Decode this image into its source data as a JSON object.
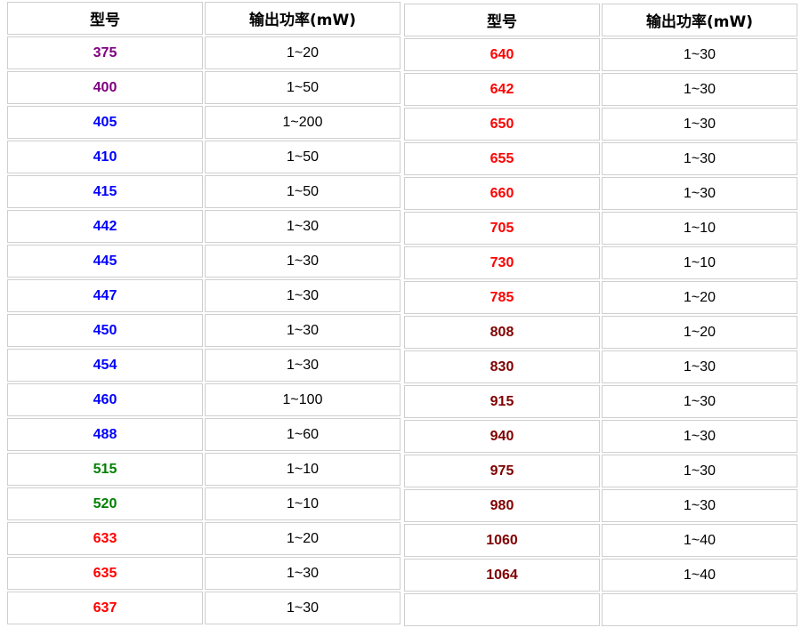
{
  "colors": {
    "purple": "#800080",
    "blue": "#0000ff",
    "green": "#008000",
    "red": "#ff0000",
    "darkred": "#800000"
  },
  "headers": {
    "model": "型号",
    "power": "输出功率(mW)"
  },
  "left_rows": [
    {
      "model": "375",
      "power": "1~20",
      "color": "#800080"
    },
    {
      "model": "400",
      "power": "1~50",
      "color": "#800080"
    },
    {
      "model": "405",
      "power": "1~200",
      "color": "#0000ff"
    },
    {
      "model": "410",
      "power": "1~50",
      "color": "#0000ff"
    },
    {
      "model": "415",
      "power": "1~50",
      "color": "#0000ff"
    },
    {
      "model": "442",
      "power": "1~30",
      "color": "#0000ff"
    },
    {
      "model": "445",
      "power": "1~30",
      "color": "#0000ff"
    },
    {
      "model": "447",
      "power": "1~30",
      "color": "#0000ff"
    },
    {
      "model": "450",
      "power": "1~30",
      "color": "#0000ff"
    },
    {
      "model": "454",
      "power": "1~30",
      "color": "#0000ff"
    },
    {
      "model": "460",
      "power": "1~100",
      "color": "#0000ff"
    },
    {
      "model": "488",
      "power": "1~60",
      "color": "#0000ff"
    },
    {
      "model": "515",
      "power": "1~10",
      "color": "#008000"
    },
    {
      "model": "520",
      "power": "1~10",
      "color": "#008000"
    },
    {
      "model": "633",
      "power": "1~20",
      "color": "#ff0000"
    },
    {
      "model": "635",
      "power": "1~30",
      "color": "#ff0000"
    },
    {
      "model": "637",
      "power": "1~30",
      "color": "#ff0000"
    }
  ],
  "right_rows": [
    {
      "model": "640",
      "power": "1~30",
      "color": "#ff0000"
    },
    {
      "model": "642",
      "power": "1~30",
      "color": "#ff0000"
    },
    {
      "model": "650",
      "power": "1~30",
      "color": "#ff0000"
    },
    {
      "model": "655",
      "power": "1~30",
      "color": "#ff0000"
    },
    {
      "model": "660",
      "power": "1~30",
      "color": "#ff0000"
    },
    {
      "model": "705",
      "power": "1~10",
      "color": "#ff0000"
    },
    {
      "model": "730",
      "power": "1~10",
      "color": "#ff0000"
    },
    {
      "model": "785",
      "power": "1~20",
      "color": "#ff0000"
    },
    {
      "model": "808",
      "power": "1~20",
      "color": "#800000"
    },
    {
      "model": "830",
      "power": "1~30",
      "color": "#800000"
    },
    {
      "model": "915",
      "power": "1~30",
      "color": "#800000"
    },
    {
      "model": "940",
      "power": "1~30",
      "color": "#800000"
    },
    {
      "model": "975",
      "power": "1~30",
      "color": "#800000"
    },
    {
      "model": "980",
      "power": "1~30",
      "color": "#800000"
    },
    {
      "model": "1060",
      "power": "1~40",
      "color": "#800000"
    },
    {
      "model": "1064",
      "power": "1~40",
      "color": "#800000"
    },
    {
      "model": "",
      "power": "",
      "color": "#000000"
    }
  ]
}
